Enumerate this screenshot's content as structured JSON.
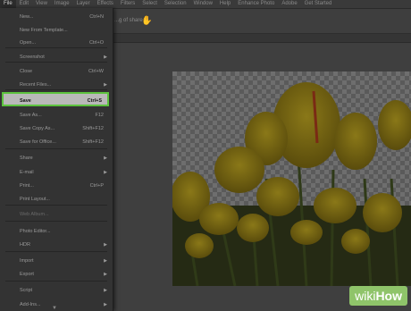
{
  "menubar": {
    "items": [
      "File",
      "Edit",
      "View",
      "Image",
      "Layer",
      "Effects",
      "Filters",
      "Select",
      "Selection",
      "Window",
      "Help",
      "Enhance Photo",
      "Adobe",
      "Get Started"
    ]
  },
  "optionsbar": {
    "text": "...g of share"
  },
  "file_menu": {
    "items": [
      {
        "label": "New...",
        "shortcut": "Ctrl+N",
        "disabled": false,
        "submenu": false
      },
      {
        "label": "New From Template...",
        "shortcut": "",
        "disabled": false,
        "submenu": false
      },
      {
        "label": "Open...",
        "shortcut": "Ctrl+O",
        "disabled": false,
        "submenu": false
      },
      {
        "label": "Screenshot",
        "shortcut": "",
        "disabled": false,
        "submenu": true
      },
      {
        "label": "Close",
        "shortcut": "Ctrl+W",
        "disabled": false,
        "submenu": false
      },
      {
        "label": "Recent Files...",
        "shortcut": "",
        "disabled": false,
        "submenu": true
      },
      {
        "label": "Save",
        "shortcut": "Ctrl+S",
        "disabled": false,
        "submenu": false,
        "highlight": true
      },
      {
        "label": "Save As...",
        "shortcut": "F12",
        "disabled": false,
        "submenu": false
      },
      {
        "label": "Save Copy As...",
        "shortcut": "Shift+F12",
        "disabled": false,
        "submenu": false
      },
      {
        "label": "Save for Office...",
        "shortcut": "Shift+F12",
        "disabled": false,
        "submenu": false
      },
      {
        "label": "Share",
        "shortcut": "",
        "disabled": false,
        "submenu": true
      },
      {
        "label": "E-mail",
        "shortcut": "",
        "disabled": false,
        "submenu": true
      },
      {
        "label": "Print...",
        "shortcut": "Ctrl+P",
        "disabled": false,
        "submenu": false
      },
      {
        "label": "Print Layout...",
        "shortcut": "",
        "disabled": false,
        "submenu": false
      },
      {
        "label": "Web Album...",
        "shortcut": "",
        "disabled": true,
        "submenu": false
      },
      {
        "label": "Photo Editor...",
        "shortcut": "",
        "disabled": false,
        "submenu": false
      },
      {
        "label": "HDR",
        "shortcut": "",
        "disabled": false,
        "submenu": true
      },
      {
        "label": "Import",
        "shortcut": "",
        "disabled": false,
        "submenu": true
      },
      {
        "label": "Export",
        "shortcut": "",
        "disabled": false,
        "submenu": true
      },
      {
        "label": "Script",
        "shortcut": "",
        "disabled": false,
        "submenu": true
      },
      {
        "label": "Add-Ins...",
        "shortcut": "",
        "disabled": false,
        "submenu": true
      }
    ],
    "scroll_down_icon": "chevron-down-icon"
  },
  "watermark": {
    "wiki": "wiki",
    "how": "How"
  },
  "colors": {
    "highlight_border": "#5cc33e",
    "watermark_bg": "#8fc46a"
  }
}
